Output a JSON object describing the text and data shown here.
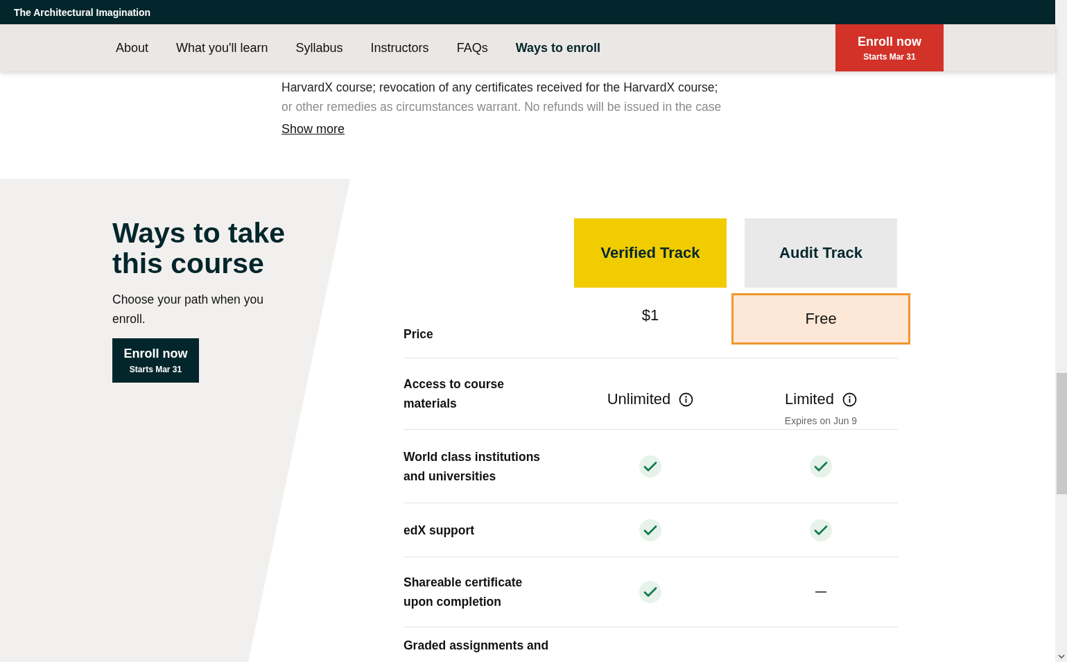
{
  "topbar": {
    "title": "The Architectural Imagination"
  },
  "nav": {
    "items": [
      {
        "label": "About",
        "selected": false
      },
      {
        "label": "What you'll learn",
        "selected": false
      },
      {
        "label": "Syllabus",
        "selected": false
      },
      {
        "label": "Instructors",
        "selected": false
      },
      {
        "label": "FAQs",
        "selected": false
      },
      {
        "label": "Ways to enroll",
        "selected": true
      }
    ],
    "enroll": {
      "label": "Enroll now",
      "sub": "Starts Mar 31"
    }
  },
  "policy": {
    "lines": [
      {
        "text": "HarvardX course; revocation of any certificates received for the HarvardX course;",
        "faded": false
      },
      {
        "text": "or other remedies as circumstances warrant. No refunds will be issued in the case",
        "faded": true
      }
    ],
    "show_more": "Show more"
  },
  "ways": {
    "heading": "Ways to take this course",
    "subtitle": "Choose your path when you enroll.",
    "enroll": {
      "label": "Enroll now",
      "sub": "Starts Mar 31"
    },
    "tracks": [
      {
        "name": "Verified Track",
        "color": "#f0cc00"
      },
      {
        "name": "Audit Track",
        "color": "#e9e9e9"
      }
    ],
    "rows": [
      {
        "label": "Price",
        "cells": [
          {
            "kind": "text",
            "text": "$1",
            "highlighted": false
          },
          {
            "kind": "text",
            "text": "Free",
            "highlighted": true
          }
        ]
      },
      {
        "label": "Access to course materials",
        "cells": [
          {
            "kind": "info",
            "text": "Unlimited"
          },
          {
            "kind": "info",
            "text": "Limited",
            "note": "Expires on Jun 9"
          }
        ]
      },
      {
        "label": "World class institutions and universities",
        "cells": [
          {
            "kind": "check"
          },
          {
            "kind": "check"
          }
        ]
      },
      {
        "label": "edX support",
        "cells": [
          {
            "kind": "check"
          },
          {
            "kind": "check"
          }
        ]
      },
      {
        "label": "Shareable certificate upon completion",
        "cells": [
          {
            "kind": "check"
          },
          {
            "kind": "dash"
          }
        ]
      },
      {
        "label": "Graded assignments and",
        "cells": []
      }
    ]
  }
}
